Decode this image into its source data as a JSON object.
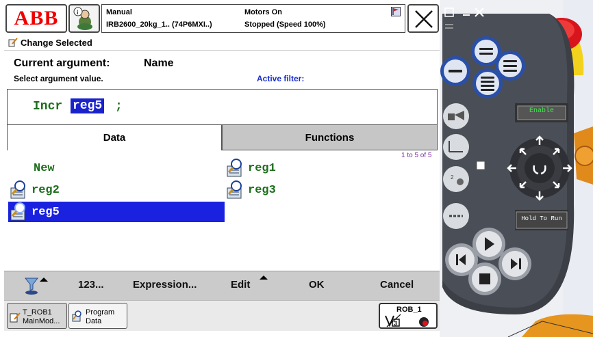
{
  "header": {
    "mode": "Manual",
    "robot": "IRB2600_20kg_1.. (74P6MXI..)",
    "motors": "Motors On",
    "state": "Stopped (Speed 100%)"
  },
  "window_title": "Change Selected",
  "argument": {
    "current_label": "Current argument:",
    "current_value": "Name",
    "select_label": "Select argument value.",
    "filter_label": "Active filter:"
  },
  "instruction": {
    "keyword": "Incr",
    "selected_arg": "reg5",
    "terminator": ";"
  },
  "tabs": {
    "data": "Data",
    "functions": "Functions"
  },
  "list_range": "1 to 5 of 5",
  "items": [
    {
      "label": "New"
    },
    {
      "label": "reg1"
    },
    {
      "label": "reg2"
    },
    {
      "label": "reg3"
    },
    {
      "label": "reg5",
      "selected": true
    }
  ],
  "bottom_bar": {
    "numeric": "123...",
    "expression": "Expression...",
    "edit": "Edit",
    "ok": "OK",
    "cancel": "Cancel"
  },
  "taskbar": {
    "task1_line1": "T_ROB1",
    "task1_line2": "MainMod...",
    "task2_line1": "Program",
    "task2_line2": "Data",
    "rob_label": "ROB_1"
  },
  "pendant": {
    "enable_label": "Enable",
    "hold_label": "Hold To Run"
  },
  "colors": {
    "selection_blue": "#1a22e0",
    "code_green": "#1d6e1d",
    "filter_blue": "#1a2ecc",
    "range_purple": "#7a2ea0",
    "abb_red": "#ee0000",
    "pendant_key_blue": "#3a6fd8",
    "emergency_red": "#d8141c",
    "guard_yellow": "#f2d21c"
  }
}
